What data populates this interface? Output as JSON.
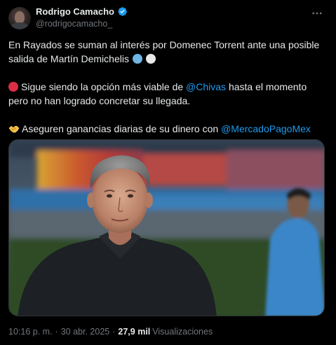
{
  "author": {
    "display_name": "Rodrigo Camacho",
    "handle": "@rodrigocamacho_",
    "verified": true
  },
  "tweet": {
    "para1": "En Rayados se suman al interés por Domenec Torrent ante una posible salida de Martín Demichelis",
    "para2_before": "Sigue siendo la opción más viable de ",
    "para2_mention": "@Chivas",
    "para2_after": " hasta el momento pero no han logrado concretar su llegada.",
    "para3_before": "Aseguren ganancias diarias de su dinero con ",
    "para3_mention": "@MercadoPagoMex"
  },
  "meta": {
    "time": "10:16 p. m.",
    "separator": "·",
    "date": "30 abr. 2025",
    "views_count": "27,9 mil",
    "views_label": "Visualizaciones"
  },
  "icons": {
    "verified": "verified-badge-icon",
    "more": "more-options-icon",
    "emoji1": "light-blue-circle-emoji",
    "emoji2": "white-circle-emoji",
    "emoji3": "red-circle-emoji",
    "emoji4": "handshake-emoji"
  },
  "colors": {
    "background": "#000000",
    "text": "#e7e9ea",
    "secondary": "#71767b",
    "link": "#1d9bf0",
    "verified": "#1d9bf0"
  }
}
